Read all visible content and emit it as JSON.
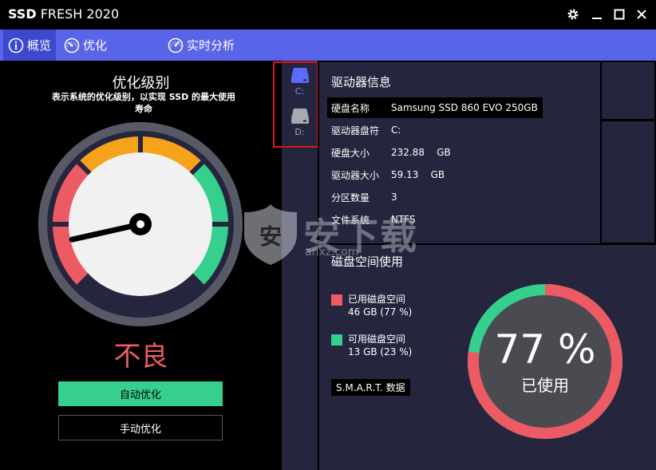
{
  "window": {
    "title_bold": "SSD",
    "title_rest": " FRESH 2020",
    "controls": [
      "gear-icon",
      "minimize-icon",
      "maximize-icon",
      "close-icon"
    ]
  },
  "nav": {
    "tabs": [
      {
        "label": "概览",
        "icon": "info-icon",
        "active": true
      },
      {
        "label": "优化",
        "icon": "speedometer-icon",
        "active": false
      },
      {
        "label": "实时分析",
        "icon": "analysis-icon",
        "active": false
      }
    ]
  },
  "optimization": {
    "title": "优化级别",
    "subtitle": "表示系统的优化级别，以实现 SSD 的最大使用寿命",
    "status": "不良",
    "gauge_level": 0.12,
    "auto_button": "自动优化",
    "manual_button": "手动优化"
  },
  "drives": [
    {
      "label": "C:",
      "selected": true
    },
    {
      "label": "D:",
      "selected": false
    }
  ],
  "drive_info": {
    "title": "驱动器信息",
    "rows": [
      {
        "key": "硬盘名称",
        "value": "Samsung SSD 860 EVO 250GB"
      },
      {
        "key": "驱动器盘符",
        "value": "C:"
      },
      {
        "key": "硬盘大小",
        "value": "232.88    GB"
      },
      {
        "key": "驱动器大小",
        "value": "59.13    GB"
      },
      {
        "key": "分区数量",
        "value": "3"
      },
      {
        "key": "文件系统",
        "value": "NTFS"
      }
    ]
  },
  "disk_usage": {
    "title": "磁盘空间使用",
    "used_label": "已用磁盘空间",
    "used_value": "46 GB (77 %)",
    "free_label": "可用磁盘空间",
    "free_value": "13 GB (23 %)",
    "used_percent_text": "77 %",
    "used_fraction": 0.77,
    "center_label": "已使用",
    "smart_button": "S.M.A.R.T. 数据"
  },
  "watermark": {
    "text": "安下载",
    "url": "anxz.com"
  },
  "colors": {
    "accent": "#5865e8",
    "active_tab": "#3c49cf",
    "panel": "#25263d",
    "used": "#ec5a64",
    "free": "#35cf8e",
    "gauge_orange": "#f7a21b",
    "highlight": "#e0141b"
  }
}
